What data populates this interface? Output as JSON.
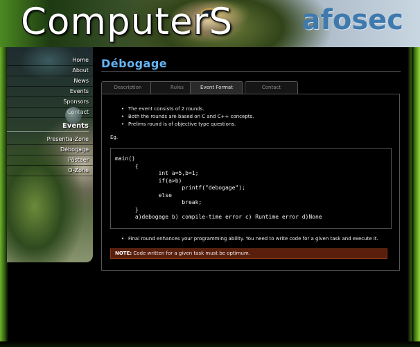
{
  "header": {
    "logo_text": "ComputerS",
    "brand_text": "afosec"
  },
  "sidebar": {
    "main_links": [
      "Home",
      "About",
      "News",
      "Events",
      "Sponsors",
      "Contact"
    ],
    "events_title": "Events",
    "event_links": [
      "Presentia-Zone",
      "Débogage",
      "Pöstaer",
      "O-Zone"
    ]
  },
  "page": {
    "title": "Débogage"
  },
  "tabs": {
    "items": [
      "Description",
      "Rules",
      "Event Format",
      "Contact"
    ],
    "active": "Event Format"
  },
  "content": {
    "bullets": [
      "The event consists of 2 rounds.",
      "Both the rounds are based on C and C++ concepts.",
      "Prelims round is of objective type questions."
    ],
    "eg_label": "Eg.",
    "code": "main()\n      {\n             int a=5,b=1;\n             if(a>b)\n                    printf(\"debogage\");\n             else\n                    break;\n      }\n      a)debogage b) compile-time error c) Runtime error d)None",
    "final_bullet": "Final round enhances your programming ability. You need to write code for a given task and execute it.",
    "note_label": "NOTE:",
    "note_text": " Code written for a given task must be optimum."
  },
  "colors": {
    "title": "#64b5f6",
    "note_bg": "#5a1e0c",
    "brand": "#3f79ad",
    "side_glow": "#7fbf2e"
  }
}
